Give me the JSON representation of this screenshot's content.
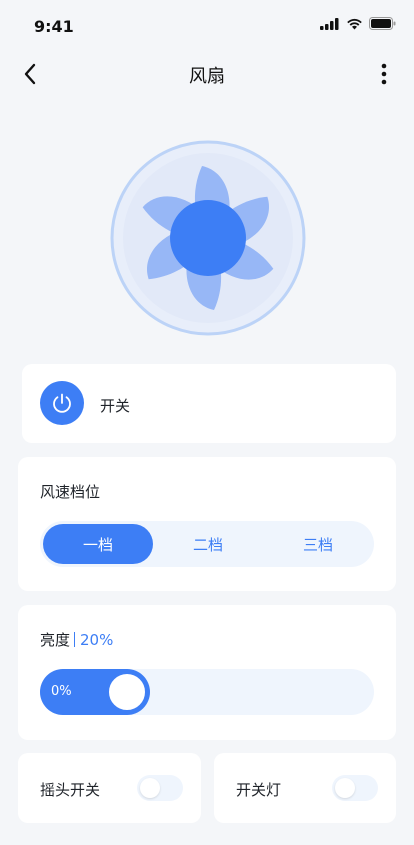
{
  "status_bar": {
    "time": "9:41"
  },
  "nav": {
    "title": "风扇"
  },
  "power": {
    "label": "开关"
  },
  "speed": {
    "title": "风速档位",
    "options": [
      "一档",
      "二档",
      "三档"
    ],
    "selected": "一档"
  },
  "brightness": {
    "title": "亮度",
    "value_text": "20%",
    "slider_label": "0%",
    "level": 0
  },
  "swing": {
    "label": "摇头开关",
    "on": false
  },
  "light": {
    "label": "开关灯",
    "on": false
  },
  "colors": {
    "accent": "#3d7ef5",
    "background": "#f4f6f9",
    "track": "#eff5fd",
    "card": "#ffffff"
  }
}
